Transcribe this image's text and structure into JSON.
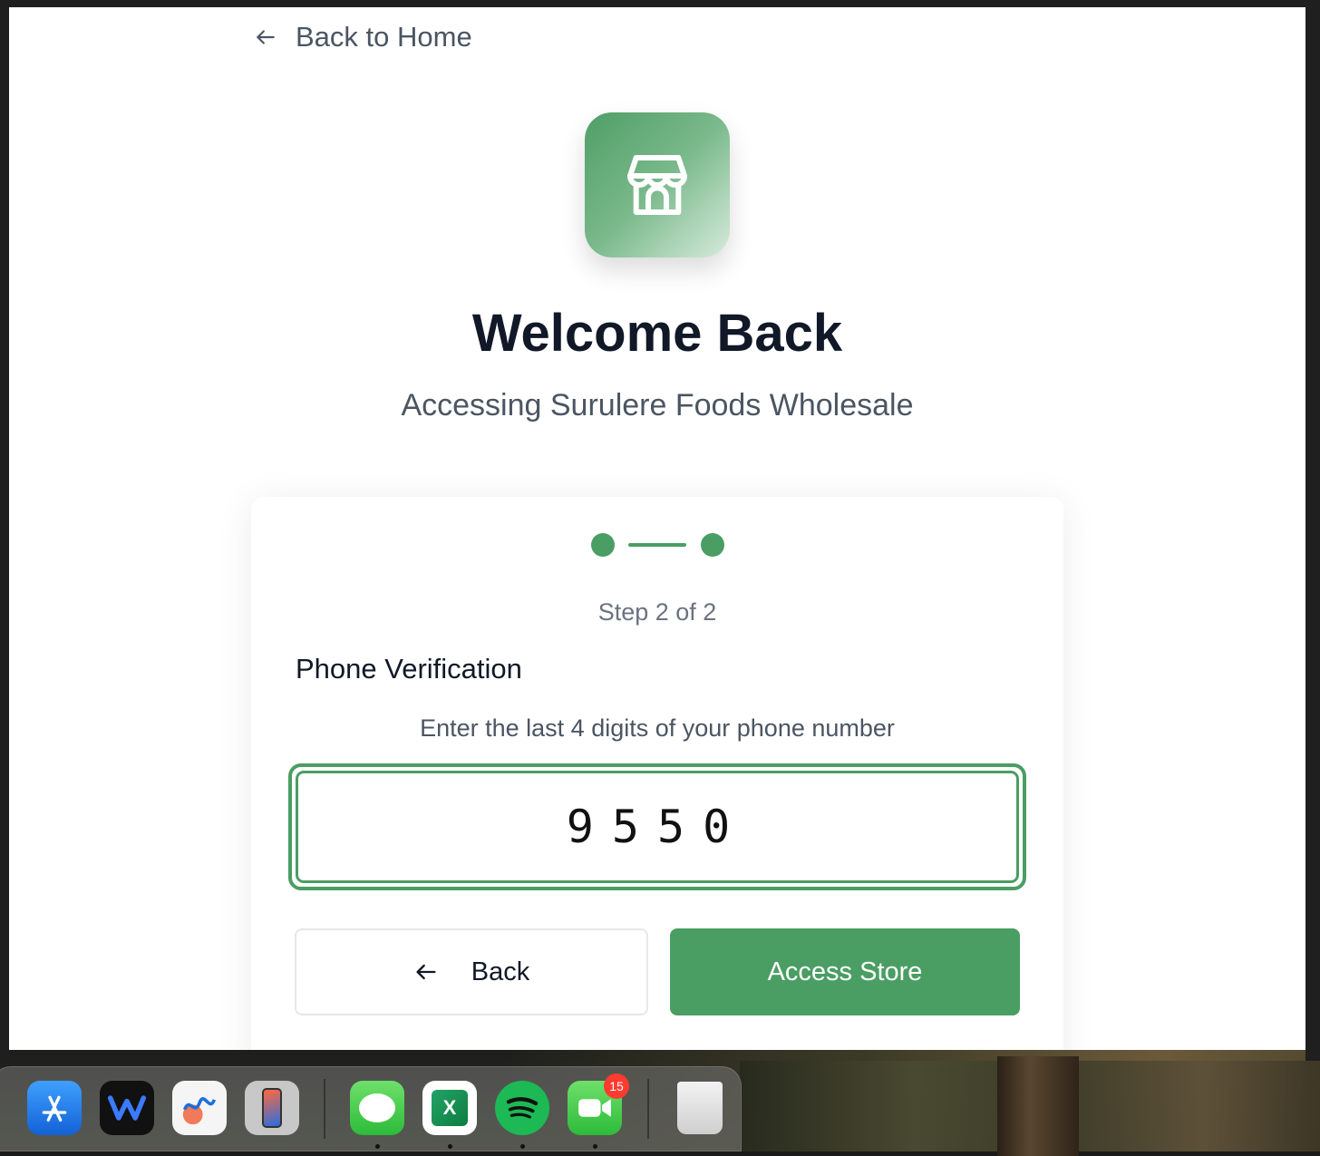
{
  "nav": {
    "back_home_label": "Back to Home"
  },
  "header": {
    "title": "Welcome Back",
    "subtitle": "Accessing Surulere Foods Wholesale"
  },
  "stepper": {
    "current_step": 2,
    "total_steps": 2,
    "label": "Step 2 of 2"
  },
  "verification": {
    "section_title": "Phone Verification",
    "instruction": "Enter the last 4 digits of your phone number",
    "code_value": "9550"
  },
  "buttons": {
    "back_label": "Back",
    "submit_label": "Access Store"
  },
  "dock": {
    "facetime_badge": "15"
  },
  "colors": {
    "accent": "#4a9e63",
    "title": "#111827",
    "muted": "#6b7280"
  }
}
